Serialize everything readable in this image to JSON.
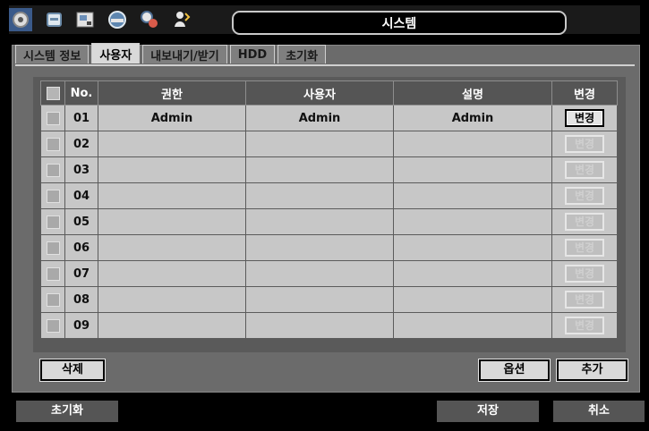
{
  "title": "시스템",
  "toolbar_icons": [
    "gear-icon",
    "cup-icon",
    "recorder-icon",
    "globe-icon",
    "network-icon",
    "user-icon"
  ],
  "tabs": [
    "시스템 정보",
    "사용자",
    "내보내기/받기",
    "HDD",
    "초기화"
  ],
  "active_tab": "사용자",
  "table": {
    "headers": {
      "no": "No.",
      "role": "권한",
      "user": "사용자",
      "desc": "설명",
      "change": "변경"
    },
    "rows": [
      {
        "no": "01",
        "role": "Admin",
        "user": "Admin",
        "desc": "Admin",
        "change": "변경",
        "enabled": true
      },
      {
        "no": "02",
        "role": "",
        "user": "",
        "desc": "",
        "change": "변경",
        "enabled": false
      },
      {
        "no": "03",
        "role": "",
        "user": "",
        "desc": "",
        "change": "변경",
        "enabled": false
      },
      {
        "no": "04",
        "role": "",
        "user": "",
        "desc": "",
        "change": "변경",
        "enabled": false
      },
      {
        "no": "05",
        "role": "",
        "user": "",
        "desc": "",
        "change": "변경",
        "enabled": false
      },
      {
        "no": "06",
        "role": "",
        "user": "",
        "desc": "",
        "change": "변경",
        "enabled": false
      },
      {
        "no": "07",
        "role": "",
        "user": "",
        "desc": "",
        "change": "변경",
        "enabled": false
      },
      {
        "no": "08",
        "role": "",
        "user": "",
        "desc": "",
        "change": "변경",
        "enabled": false
      },
      {
        "no": "09",
        "role": "",
        "user": "",
        "desc": "",
        "change": "변경",
        "enabled": false
      }
    ]
  },
  "buttons": {
    "delete": "삭제",
    "option": "옵션",
    "add": "추가",
    "reset": "초기화",
    "save": "저장",
    "cancel": "취소"
  }
}
